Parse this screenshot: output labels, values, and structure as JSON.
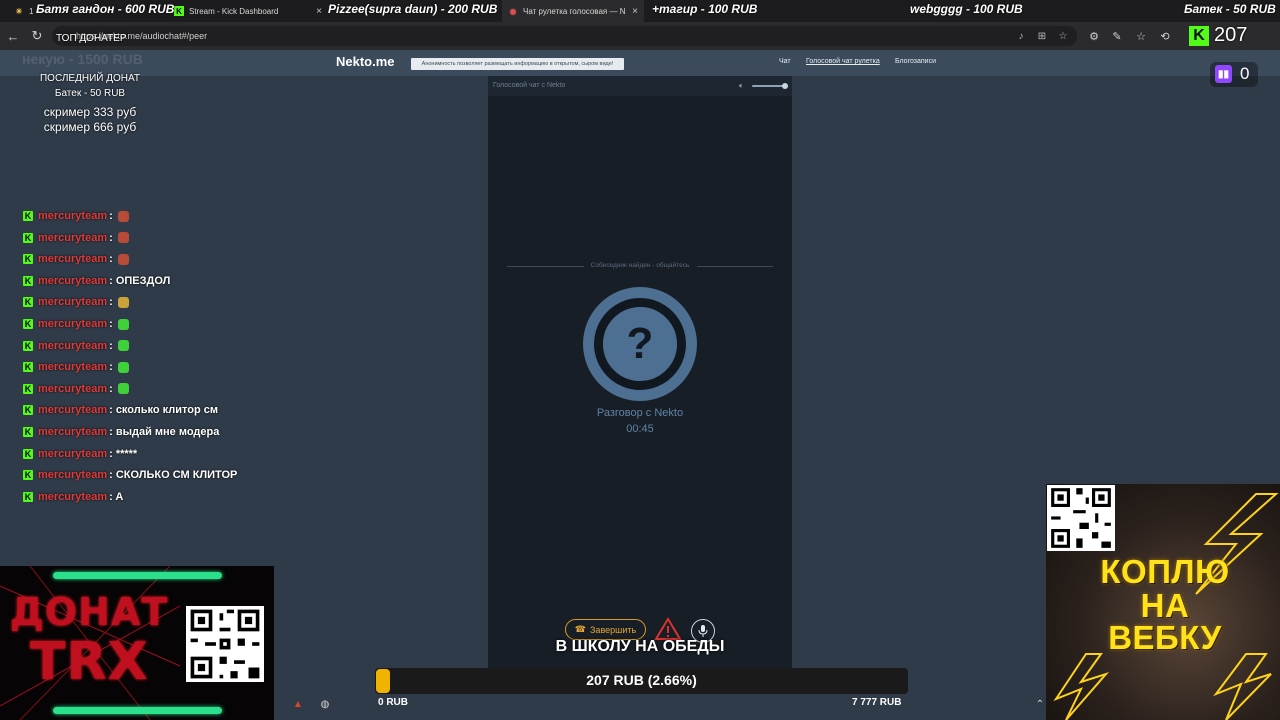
{
  "browser": {
    "tabs": [
      {
        "label": "1",
        "active": false
      },
      {
        "label": "Stream - Kick Dashboard",
        "active": false
      },
      {
        "label": "Чат рулетка голосовая — N",
        "active": true
      }
    ],
    "url": "https://nekto.me/audiochat#/peer"
  },
  "alerts": {
    "a1": "Батя гандон - 600 RUB",
    "a2": "Pizzee(supra daun) - 200 RUB",
    "a3": "+тагир - 100 RUB",
    "a4": "webgggg - 100 RUB",
    "a5": "Батек - 50 RUB"
  },
  "counters": {
    "kick_viewers": "207",
    "twitch_viewers": "0"
  },
  "donations": {
    "top_title": "ТОП ДОНАТЕР",
    "top_ghost": "некую - 1500 RUB",
    "last_title": "ПОСЛЕДНИЙ ДОНАТ",
    "last_value": "Батек - 50 RUB",
    "line1": "скример 333 руб",
    "line2": "скример 666 руб"
  },
  "site": {
    "logo": "Nekto.me",
    "notice": "Анонимность позволяет размещать информацию в открытом, сыром виде!",
    "menu": [
      "Чат",
      "Голосовой чат рулетка",
      "Блогозаписи"
    ]
  },
  "call": {
    "panel_title": "Голосовой чат с Nekto",
    "separator": "Собеседник найден - общайтесь",
    "question": "?",
    "talk_label": "Разговор с Nekto",
    "timer": "00:45",
    "end_label": "Завершить"
  },
  "chat": [
    {
      "user": "mercuryteam",
      "msg": ":",
      "emote": "#b84a3a"
    },
    {
      "user": "mercuryteam",
      "msg": ":",
      "emote": "#b84a3a"
    },
    {
      "user": "mercuryteam",
      "msg": ":",
      "emote": "#b84a3a"
    },
    {
      "user": "mercuryteam",
      "msg": ": ОПЕЗДОЛ",
      "emote": ""
    },
    {
      "user": "mercuryteam",
      "msg": ":",
      "emote": "#c9a23a"
    },
    {
      "user": "mercuryteam",
      "msg": ":",
      "emote": "#3fd13a"
    },
    {
      "user": "mercuryteam",
      "msg": ":",
      "emote": "#3fd13a"
    },
    {
      "user": "mercuryteam",
      "msg": ":",
      "emote": "#3fd13a"
    },
    {
      "user": "mercuryteam",
      "msg": ":",
      "emote": "#3fd13a"
    },
    {
      "user": "mercuryteam",
      "msg": ": сколько клитор см",
      "emote": ""
    },
    {
      "user": "mercuryteam",
      "msg": ": выдай мне модера",
      "emote": ""
    },
    {
      "user": "mercuryteam",
      "msg": ": *****",
      "emote": ""
    },
    {
      "user": "mercuryteam",
      "msg": ": СКОЛЬКО СМ КЛИТОР",
      "emote": ""
    },
    {
      "user": "mercuryteam",
      "msg": ": A",
      "emote": ""
    }
  ],
  "donate_widget": {
    "line1": "ДОНАТ",
    "line2": "TRX"
  },
  "goal": {
    "title": "В ШКОЛУ НА ОБЕДЫ",
    "current": "207 RUB (2.66%)",
    "progress": 0.0266,
    "min": "0 RUB",
    "max": "7 777 RUB"
  },
  "webcam": {
    "line1": "КОПЛЮ",
    "line2": "НА",
    "line3": "ВЕБКУ"
  },
  "colors": {
    "kick_green": "#53fc18",
    "twitch_purple": "#9146ff",
    "chat_user": "#e03a3a",
    "goal_fill": "#f0b400",
    "accent_orange": "#e4a637"
  }
}
